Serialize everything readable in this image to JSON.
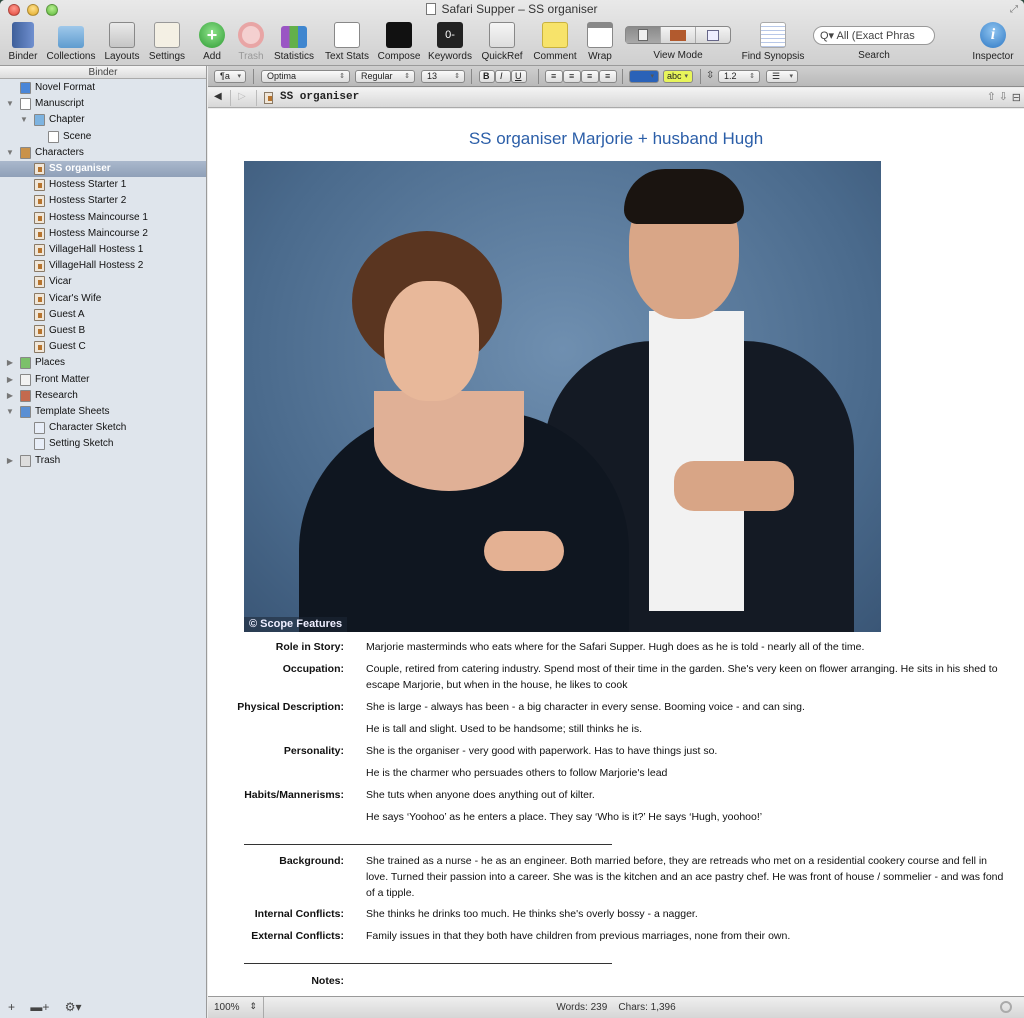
{
  "window": {
    "title": "Safari Supper – SS organiser"
  },
  "toolbar": {
    "items": [
      {
        "label": "Binder",
        "icon": "binder-icon"
      },
      {
        "label": "Collections",
        "icon": "collections-icon"
      },
      {
        "label": "Layouts",
        "icon": "layouts-icon"
      },
      {
        "label": "Settings",
        "icon": "settings-icon"
      },
      {
        "label": "Add",
        "icon": "add-icon"
      },
      {
        "label": "Trash",
        "icon": "trash-icon",
        "disabled": true
      },
      {
        "label": "Statistics",
        "icon": "statistics-icon"
      },
      {
        "label": "Text Stats",
        "icon": "text-stats-icon"
      },
      {
        "label": "Compose",
        "icon": "compose-icon"
      },
      {
        "label": "Keywords",
        "icon": "keywords-icon"
      },
      {
        "label": "QuickRef",
        "icon": "quickref-icon"
      },
      {
        "label": "Comment",
        "icon": "comment-icon"
      },
      {
        "label": "Wrap",
        "icon": "wrap-icon"
      }
    ],
    "view_mode_label": "View Mode",
    "find_synopsis_label": "Find Synopsis",
    "search_placeholder": "All (Exact Phras",
    "search_label": "Search",
    "inspector_label": "Inspector"
  },
  "binder": {
    "header": "Binder",
    "items": [
      {
        "label": "Novel Format",
        "level": 0,
        "icon": "info-icon"
      },
      {
        "label": "Manuscript",
        "level": 0,
        "icon": "manuscript-icon",
        "expanded": true
      },
      {
        "label": "Chapter",
        "level": 1,
        "icon": "folder-icon",
        "expanded": true
      },
      {
        "label": "Scene",
        "level": 2,
        "icon": "document-icon"
      },
      {
        "label": "Characters",
        "level": 0,
        "icon": "characters-icon",
        "expanded": true
      },
      {
        "label": "SS organiser",
        "level": 1,
        "icon": "character-sheet-icon",
        "selected": true
      },
      {
        "label": "Hostess Starter 1",
        "level": 1,
        "icon": "character-sheet-icon"
      },
      {
        "label": "Hostess Starter 2",
        "level": 1,
        "icon": "character-sheet-icon"
      },
      {
        "label": "Hostess Maincourse 1",
        "level": 1,
        "icon": "character-sheet-icon"
      },
      {
        "label": "Hostess Maincourse 2",
        "level": 1,
        "icon": "character-sheet-icon"
      },
      {
        "label": "VillageHall Hostess 1",
        "level": 1,
        "icon": "character-sheet-icon"
      },
      {
        "label": "VillageHall Hostess 2",
        "level": 1,
        "icon": "character-sheet-icon"
      },
      {
        "label": "Vicar",
        "level": 1,
        "icon": "character-sheet-icon"
      },
      {
        "label": "Vicar's Wife",
        "level": 1,
        "icon": "character-sheet-icon"
      },
      {
        "label": "Guest A",
        "level": 1,
        "icon": "character-sheet-icon"
      },
      {
        "label": "Guest B",
        "level": 1,
        "icon": "character-sheet-icon"
      },
      {
        "label": "Guest C",
        "level": 1,
        "icon": "character-sheet-icon"
      },
      {
        "label": "Places",
        "level": 0,
        "icon": "places-icon",
        "expanded": false
      },
      {
        "label": "Front Matter",
        "level": 0,
        "icon": "front-matter-icon",
        "expanded": false
      },
      {
        "label": "Research",
        "level": 0,
        "icon": "research-icon",
        "expanded": false
      },
      {
        "label": "Template Sheets",
        "level": 0,
        "icon": "template-icon",
        "expanded": true
      },
      {
        "label": "Character Sketch",
        "level": 1,
        "icon": "template-sheet-icon"
      },
      {
        "label": "Setting Sketch",
        "level": 1,
        "icon": "template-sheet-icon"
      },
      {
        "label": "Trash",
        "level": 0,
        "icon": "trash-icon",
        "expanded": false
      }
    ],
    "footer": {
      "add": "+",
      "add_folder": "▬+",
      "gear": "⚙▾"
    }
  },
  "formatbar": {
    "style": "¶a",
    "font": "Optima",
    "weight": "Regular",
    "size": "13",
    "bold": "B",
    "italic": "I",
    "underline": "U",
    "text_color": "#2a62b8",
    "highlight_label": "abc",
    "highlight_color": "#e8f55a",
    "line_spacing": "1.2"
  },
  "header": {
    "doc_title": "SS organiser"
  },
  "document": {
    "title": "SS organiser Marjorie + husband Hugh",
    "photo_credit": "© Scope Features",
    "fields": [
      {
        "label": "Role in Story:",
        "lines": [
          "Marjorie masterminds who eats where for the Safari Supper. Hugh does as he is told - nearly all of the time."
        ]
      },
      {
        "label": "Occupation:",
        "lines": [
          "Couple, retired from catering industry. Spend most of their time in the garden. She's very keen on flower arranging. He sits in his shed to escape Marjorie, but when in the house, he likes to cook"
        ]
      },
      {
        "label": "Physical Description:",
        "lines": [
          "She is large - always has been - a big character in every sense. Booming voice - and can sing.",
          "He is tall and slight. Used to be handsome; still thinks he is."
        ]
      },
      {
        "label": "Personality:",
        "lines": [
          "She is the organiser - very good with paperwork. Has to have things just so.",
          "He is the charmer who persuades others to follow Marjorie's lead"
        ]
      },
      {
        "label": "Habits/Mannerisms:",
        "lines": [
          "She tuts when anyone does anything out of kilter.",
          "He says ‘Yoohoo’ as he enters a place. They say ‘Who is it?’ He says ‘Hugh, yoohoo!’"
        ]
      }
    ],
    "fields2": [
      {
        "label": "Background:",
        "lines": [
          "She trained as a nurse - he as an engineer. Both married before, they are retreads who met on a residential cookery course and fell in love. Turned their passion into a career. She was is the kitchen and an ace pastry chef. He was front of house / sommelier - and was fond of a tipple."
        ]
      },
      {
        "label": "Internal Conflicts:",
        "lines": [
          "She thinks he drinks too much. He thinks she's overly bossy - a nagger."
        ]
      },
      {
        "label": "External Conflicts:",
        "lines": [
          "Family issues in that they both have children from previous marriages, none from their own."
        ]
      }
    ],
    "notes_label": "Notes:"
  },
  "footer": {
    "zoom": "100%",
    "words": "Words: 239",
    "chars": "Chars: 1,396"
  }
}
